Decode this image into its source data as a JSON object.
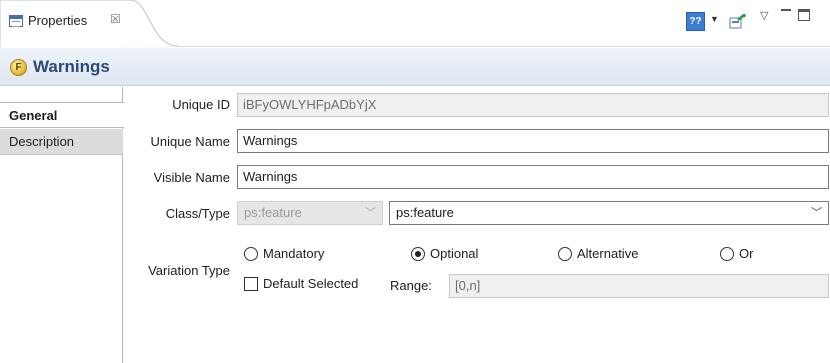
{
  "tab": {
    "title": "Properties",
    "close": "☒"
  },
  "toolbar": {
    "help": "??",
    "view_menu": "▽"
  },
  "header": {
    "title": "Warnings",
    "icon_letter": "F"
  },
  "side_tabs": [
    "General",
    "Description"
  ],
  "form": {
    "unique_id": {
      "label": "Unique ID",
      "value": "iBFyOWLYHFpADbYjX"
    },
    "unique_name": {
      "label": "Unique Name",
      "value": "Warnings"
    },
    "visible_name": {
      "label": "Visible Name",
      "value": "Warnings"
    },
    "class_type": {
      "label": "Class/Type",
      "left_value": "ps:feature",
      "right_value": "ps:feature"
    },
    "variation_type": {
      "label": "Variation Type",
      "options": [
        "Mandatory",
        "Optional",
        "Alternative",
        "Or"
      ],
      "selected": "Optional",
      "default_selected_label": "Default Selected",
      "default_selected_checked": false,
      "range_label": "Range:",
      "range_value": "[0,n]"
    }
  }
}
